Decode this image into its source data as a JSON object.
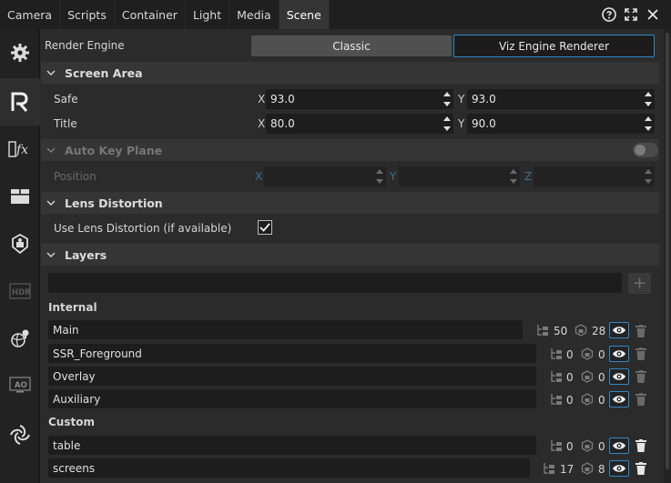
{
  "tabs": [
    {
      "label": "Camera"
    },
    {
      "label": "Scripts"
    },
    {
      "label": "Container"
    },
    {
      "label": "Light"
    },
    {
      "label": "Media"
    },
    {
      "label": "Scene",
      "active": true
    }
  ],
  "render_engine": {
    "label": "Render Engine",
    "options": [
      "Classic",
      "Viz Engine Renderer"
    ],
    "selected": "Viz Engine Renderer"
  },
  "screen_area": {
    "title": "Screen Area",
    "safe": {
      "label": "Safe",
      "x_axis": "X",
      "x": "93.0",
      "y_axis": "Y",
      "y": "93.0"
    },
    "title_row": {
      "label": "Title",
      "x_axis": "X",
      "x": "80.0",
      "y_axis": "Y",
      "y": "90.0"
    }
  },
  "auto_key_plane": {
    "title": "Auto Key Plane",
    "enabled": false,
    "position": {
      "label": "Position",
      "x_axis": "X",
      "x": "",
      "y_axis": "Y",
      "y": "",
      "z_axis": "Z",
      "z": ""
    }
  },
  "lens_distortion": {
    "title": "Lens Distortion",
    "use_label": "Use Lens Distortion (if available)",
    "checked": true
  },
  "layers": {
    "title": "Layers",
    "add_label": "+",
    "internal_label": "Internal",
    "internal": [
      {
        "name": "Main",
        "objects": "50",
        "containers": "28"
      },
      {
        "name": "SSR_Foreground",
        "objects": "0",
        "containers": "0"
      },
      {
        "name": "Overlay",
        "objects": "0",
        "containers": "0"
      },
      {
        "name": "Auxiliary",
        "objects": "0",
        "containers": "0"
      }
    ],
    "custom_label": "Custom",
    "custom": [
      {
        "name": "table",
        "objects": "0",
        "containers": "0"
      },
      {
        "name": "screens",
        "objects": "17",
        "containers": "8"
      }
    ]
  },
  "colors": {
    "accent": "#2f89c8",
    "background": "#2b2b2b",
    "section": "#353535",
    "field": "#1d1d1d"
  },
  "icons": [
    "help-icon",
    "expand-icon",
    "close-icon",
    "gear-icon",
    "renderer-r-icon",
    "fx-icon",
    "layout-icon",
    "camera-shield-icon",
    "hdr-icon",
    "globe-light-icon",
    "ao-icon",
    "swirl-icon"
  ]
}
